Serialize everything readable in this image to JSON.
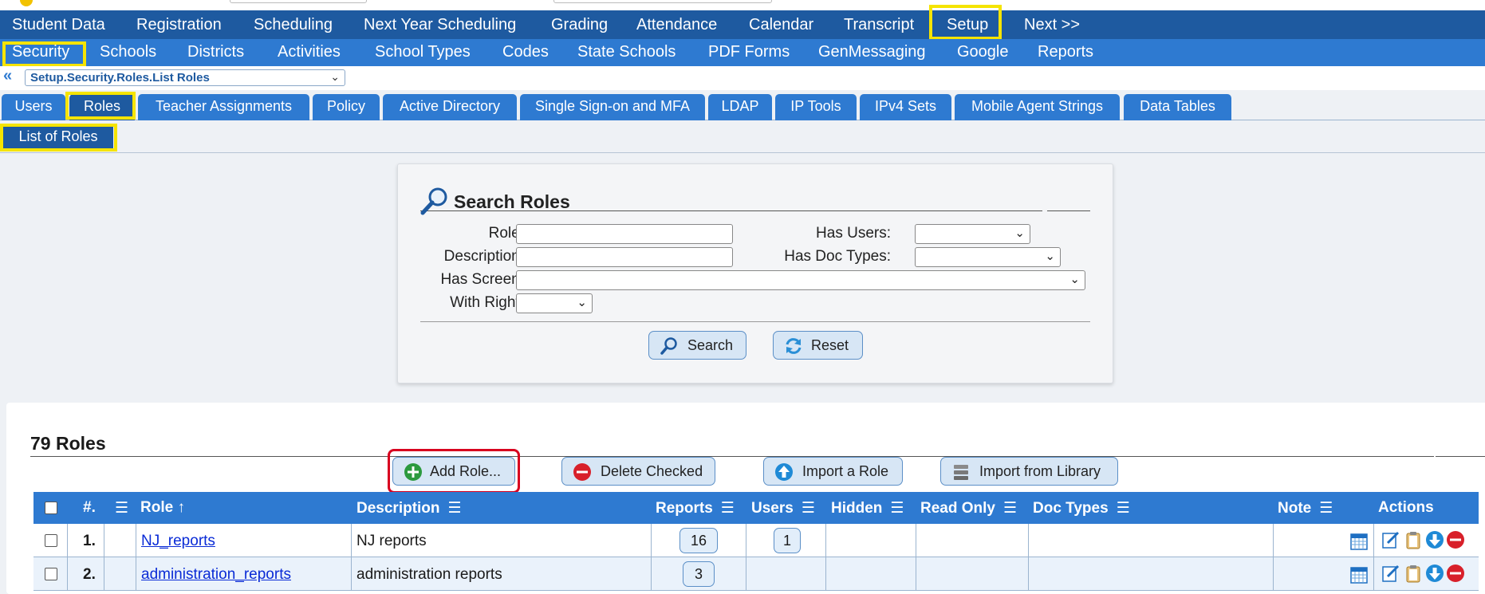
{
  "nav_primary": [
    "Student Data",
    "Registration",
    "Scheduling",
    "Next Year Scheduling",
    "Grading",
    "Attendance",
    "Calendar",
    "Transcript",
    "Setup",
    "Next >>"
  ],
  "nav_secondary": [
    "Security",
    "Schools",
    "Districts",
    "Activities",
    "School Types",
    "Codes",
    "State Schools",
    "PDF Forms",
    "GenMessaging",
    "Google",
    "Reports"
  ],
  "breadcrumb": {
    "value": "Setup.Security.Roles.List Roles"
  },
  "tabs": [
    "Users",
    "Roles",
    "Teacher Assignments",
    "Policy",
    "Active Directory",
    "Single Sign-on and MFA",
    "LDAP",
    "IP Tools",
    "IPv4 Sets",
    "Mobile Agent Strings",
    "Data Tables"
  ],
  "subtab": "List of Roles",
  "search": {
    "title": "Search Roles",
    "role_label": "Role:",
    "description_label": "Description:",
    "has_screen_label": "Has Screen:",
    "with_right_label": "With Right:",
    "has_users_label": "Has Users:",
    "has_doc_types_label": "Has Doc Types:",
    "search_button": "Search",
    "reset_button": "Reset"
  },
  "list": {
    "count_label": "79 Roles",
    "add_button": "Add Role...",
    "delete_button": "Delete Checked",
    "import_button": "Import a Role",
    "import_library_button": "Import from Library"
  },
  "table": {
    "headers": {
      "num": "#.",
      "role": "Role",
      "sort": "↑",
      "description": "Description",
      "reports": "Reports",
      "users": "Users",
      "hidden": "Hidden",
      "read_only": "Read Only",
      "doc_types": "Doc Types",
      "note": "Note",
      "actions": "Actions",
      "menu": "☰"
    },
    "rows": [
      {
        "num": "1.",
        "role": "NJ_reports",
        "description": "NJ reports",
        "reports": "16",
        "users": "1"
      },
      {
        "num": "2.",
        "role": "administration_reports",
        "description": "administration reports",
        "reports": "3",
        "users": ""
      }
    ]
  },
  "colors": {
    "nav_dark": "#1e5aa0",
    "nav_light": "#2e7ad1",
    "highlight": "#f5e400",
    "add_highlight": "#d8001f"
  }
}
